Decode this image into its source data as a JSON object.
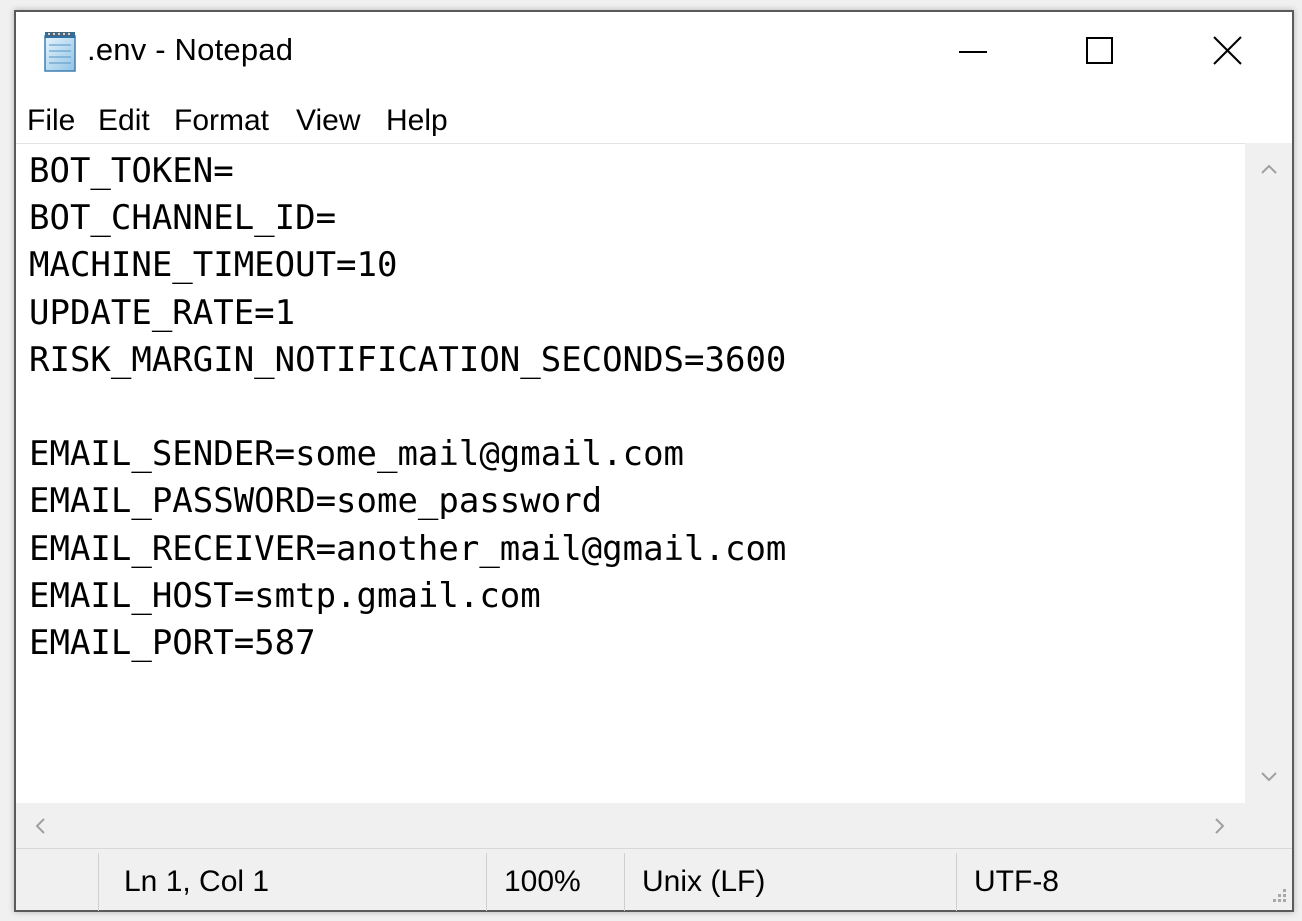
{
  "window": {
    "title": ".env - Notepad",
    "app_icon": "notepad-icon"
  },
  "controls": {
    "minimize_icon": "minimize-icon",
    "maximize_icon": "maximize-icon",
    "close_icon": "close-icon"
  },
  "menu": {
    "items": [
      {
        "label": "File"
      },
      {
        "label": "Edit"
      },
      {
        "label": "Format"
      },
      {
        "label": "View"
      },
      {
        "label": "Help"
      }
    ]
  },
  "editor": {
    "text": "BOT_TOKEN=\nBOT_CHANNEL_ID=\nMACHINE_TIMEOUT=10\nUPDATE_RATE=1\nRISK_MARGIN_NOTIFICATION_SECONDS=3600\n\nEMAIL_SENDER=some_mail@gmail.com\nEMAIL_PASSWORD=some_password\nEMAIL_RECEIVER=another_mail@gmail.com\nEMAIL_HOST=smtp.gmail.com\nEMAIL_PORT=587"
  },
  "statusbar": {
    "position": "Ln 1, Col 1",
    "zoom": "100%",
    "line_ending": "Unix (LF)",
    "encoding": "UTF-8"
  },
  "colors": {
    "window_border": "#5a5a5a",
    "chrome_background": "#f0f0f0",
    "editor_background": "#ffffff",
    "scroll_arrow": "#a0a0a0"
  }
}
